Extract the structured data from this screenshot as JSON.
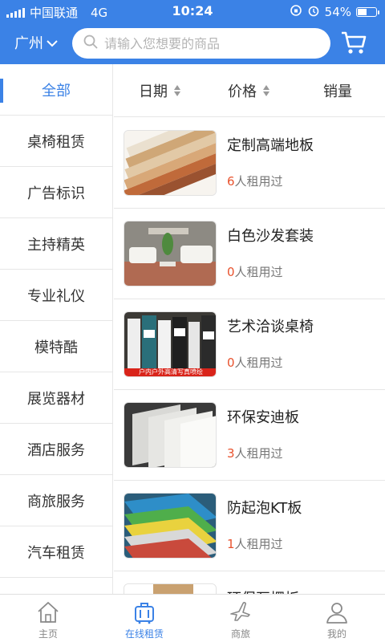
{
  "status": {
    "carrier": "中国联通",
    "network": "4G",
    "time": "10:24",
    "battery": "54%",
    "battery_level": 0.54
  },
  "header": {
    "city": "广州",
    "search_placeholder": "请输入您想要的商品"
  },
  "sidebar": {
    "items": [
      {
        "label": "全部",
        "active": true
      },
      {
        "label": "桌椅租赁"
      },
      {
        "label": "广告标识"
      },
      {
        "label": "主持精英"
      },
      {
        "label": "专业礼仪"
      },
      {
        "label": "模特酷"
      },
      {
        "label": "展览器材"
      },
      {
        "label": "酒店服务"
      },
      {
        "label": "商旅服务"
      },
      {
        "label": "汽车租赁"
      }
    ]
  },
  "sortbar": {
    "date": "日期",
    "price": "价格",
    "sales": "销量"
  },
  "products": [
    {
      "name": "定制高端地板",
      "count": "6",
      "suffix": "人租用过"
    },
    {
      "name": "白色沙发套装",
      "count": "0",
      "suffix": "人租用过"
    },
    {
      "name": "艺术洽谈桌椅",
      "count": "0",
      "suffix": "人租用过",
      "banner": "户内户外高清写真喷绘"
    },
    {
      "name": "环保安迪板",
      "count": "3",
      "suffix": "人租用过"
    },
    {
      "name": "防起泡KT板",
      "count": "1",
      "suffix": "人租用过"
    },
    {
      "name": "环保瓦楞板",
      "count": "",
      "suffix": ""
    }
  ],
  "tabs": [
    {
      "label": "主页"
    },
    {
      "label": "在线租赁",
      "active": true
    },
    {
      "label": "商旅"
    },
    {
      "label": "我的"
    }
  ],
  "colors": {
    "brand": "#3b82e6",
    "count": "#e8522d"
  }
}
